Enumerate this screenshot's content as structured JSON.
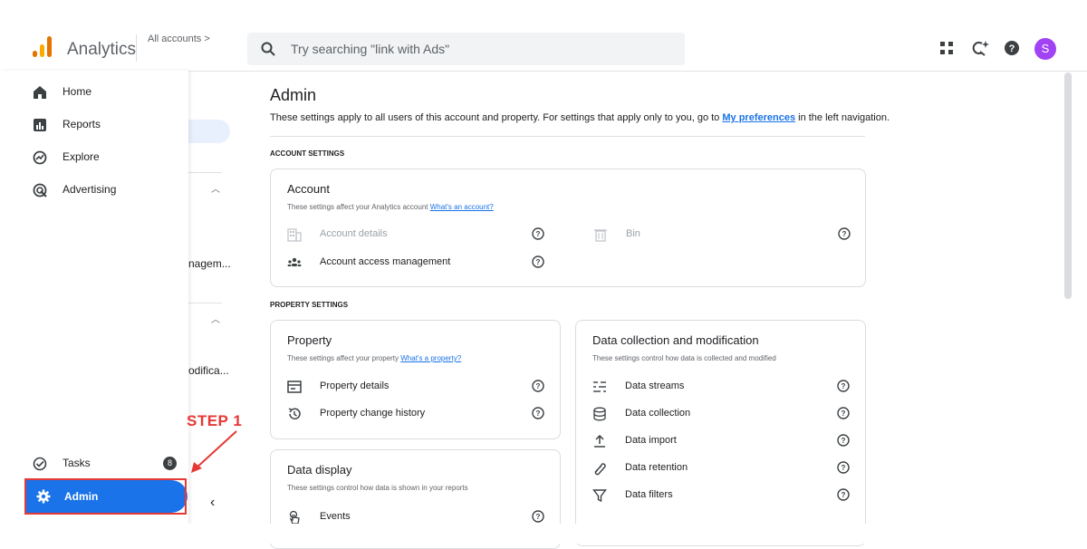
{
  "header": {
    "app_title": "Analytics",
    "breadcrumb": "All accounts >",
    "search_placeholder": "Try searching \"link with Ads\"",
    "avatar_initial": "S",
    "icons": [
      "apps-grid-icon",
      "search-insights-icon",
      "help-icon"
    ],
    "accent_color": "#1a73e8"
  },
  "nav": {
    "items": [
      {
        "label": "Home",
        "icon": "home-icon"
      },
      {
        "label": "Reports",
        "icon": "reports-icon"
      },
      {
        "label": "Explore",
        "icon": "explore-icon"
      },
      {
        "label": "Advertising",
        "icon": "advertising-icon"
      }
    ],
    "tasks": {
      "label": "Tasks",
      "badge": "8"
    },
    "admin": {
      "label": "Admin"
    }
  },
  "annotation": {
    "step": "STEP 1",
    "color": "#e53935"
  },
  "secondary": {
    "text1": "nagem...",
    "text2": "odifica..."
  },
  "main": {
    "title": "Admin",
    "description_before": "These settings apply to all users of this account and property. For settings that apply only to you, go to ",
    "description_link": "My preferences",
    "description_after": " in the left navigation.",
    "account_section_label": "ACCOUNT SETTINGS",
    "property_section_label": "PROPERTY SETTINGS",
    "account_card": {
      "title": "Account",
      "desc": "These settings affect your Analytics account ",
      "desc_link": "What's an account?",
      "rows": [
        {
          "label": "Account details",
          "icon": "building-icon"
        },
        {
          "label": "Bin",
          "icon": "trash-icon"
        },
        {
          "label": "Account access management",
          "icon": "people-icon"
        }
      ]
    },
    "property_card": {
      "title": "Property",
      "desc": "These settings affect your property ",
      "desc_link": "What's a property?",
      "rows": [
        {
          "label": "Property details",
          "icon": "card-icon"
        },
        {
          "label": "Property change history",
          "icon": "history-icon"
        }
      ]
    },
    "data_display_card": {
      "title": "Data display",
      "desc": "These settings control how data is shown in your reports",
      "rows": [
        {
          "label": "Events",
          "icon": "touch-icon"
        }
      ]
    },
    "data_collection_card": {
      "title": "Data collection and modification",
      "desc": "These settings control how data is collected and modified",
      "rows": [
        {
          "label": "Data streams",
          "icon": "streams-icon"
        },
        {
          "label": "Data collection",
          "icon": "database-icon"
        },
        {
          "label": "Data import",
          "icon": "upload-icon"
        },
        {
          "label": "Data retention",
          "icon": "retention-icon"
        },
        {
          "label": "Data filters",
          "icon": "filter-icon"
        }
      ]
    }
  }
}
